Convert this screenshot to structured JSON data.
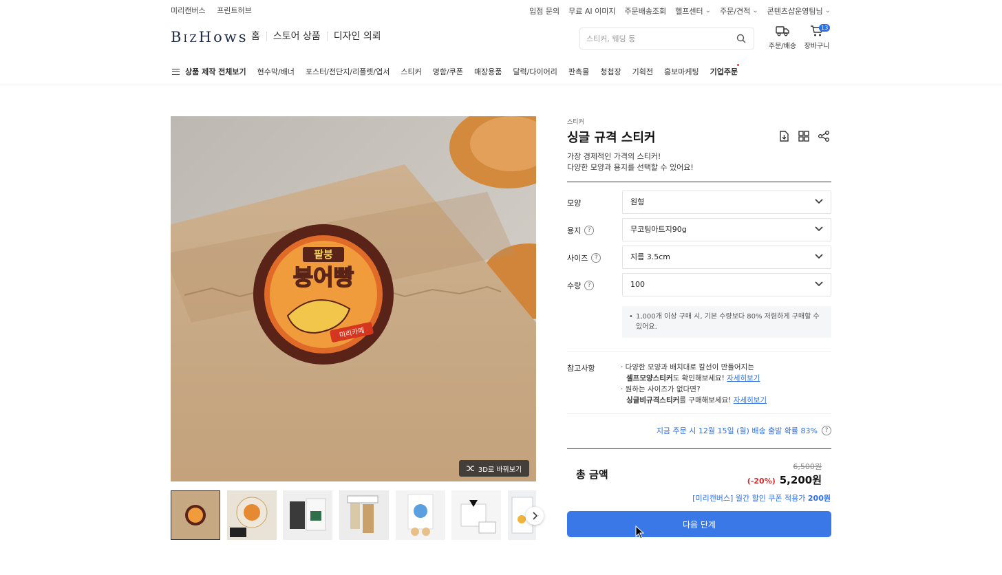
{
  "colors": {
    "accent": "#2d6fe3",
    "primary_button": "#3a78e8",
    "discount": "#d32f2f"
  },
  "util": {
    "left": [
      "미리캔버스",
      "프린트허브"
    ],
    "right": [
      {
        "label": "입점 문의",
        "dropdown": false
      },
      {
        "label": "무료 AI 이미지",
        "dropdown": false
      },
      {
        "label": "주문배송조회",
        "dropdown": false
      },
      {
        "label": "헬프센터",
        "dropdown": true
      },
      {
        "label": "주문/견적",
        "dropdown": true
      },
      {
        "label": "콘텐츠샵운영팀님",
        "dropdown": true
      }
    ]
  },
  "header": {
    "logo_a": "Biz",
    "logo_b": "Hows",
    "nav": [
      "홈",
      "스토어 상품",
      "디자인 의뢰"
    ],
    "search_placeholder": "스티커, 웨딩 등",
    "order_label": "주문/배송",
    "cart_label": "장바구니",
    "cart_count": "13"
  },
  "catbar": {
    "all": "상품 제작 전체보기",
    "items": [
      "현수막/배너",
      "포스터/전단지/리플렛/엽서",
      "스티커",
      "명함/쿠폰",
      "매장용품",
      "달력/다이어리",
      "판촉물",
      "청첩장",
      "기획전",
      "홍보마케팅"
    ],
    "strong": "기업주문"
  },
  "gallery": {
    "btn3d": "3D로 바꿔보기",
    "sticker_line1": "팥붕",
    "sticker_line2": "붕어빵",
    "sticker_ribbon": "미리카페",
    "thumb_count": 7
  },
  "product": {
    "category": "스티커",
    "title": "싱글 규격 스티커",
    "desc1": "가장 경제적인 가격의 스티커!",
    "desc2": "다양한 모양과 용지를 선택할 수 있어요!",
    "options": [
      {
        "label": "모양",
        "value": "원형",
        "help": false
      },
      {
        "label": "용지",
        "value": "무코팅아트지90g",
        "help": true
      },
      {
        "label": "사이즈",
        "value": "지름 3.5cm",
        "help": true
      },
      {
        "label": "수량",
        "value": "100",
        "help": true
      }
    ],
    "notice": "1,000개 이상 구매 시, 기본 수량보다 80% 저렴하게 구매할 수 있어요.",
    "ref_label": "참고사항",
    "ref1_a": "· 다양한 모양과 배치대로 칼선이 만들어지는",
    "ref1_b_strong": "셀프모양스티커",
    "ref1_b_rest": "도 확인해보세요!",
    "ref2_a": "· 원하는 사이즈가 없다면?",
    "ref2_b_strong": "싱글비규격스티커",
    "ref2_b_rest": "를 구매해보세요!",
    "ref_link": "자세히보기",
    "shipping": "지금 주문 시 12월 15일 (월) 배송 출발 확률 83%",
    "total_label": "총 금액",
    "original_price": "6,500원",
    "discount": "(-20%)",
    "final_price": "5,200원",
    "coupon_text": "[미리캔버스] 월간 할인 쿠폰 적용가",
    "coupon_price": "200원",
    "next_button": "다음 단계"
  }
}
